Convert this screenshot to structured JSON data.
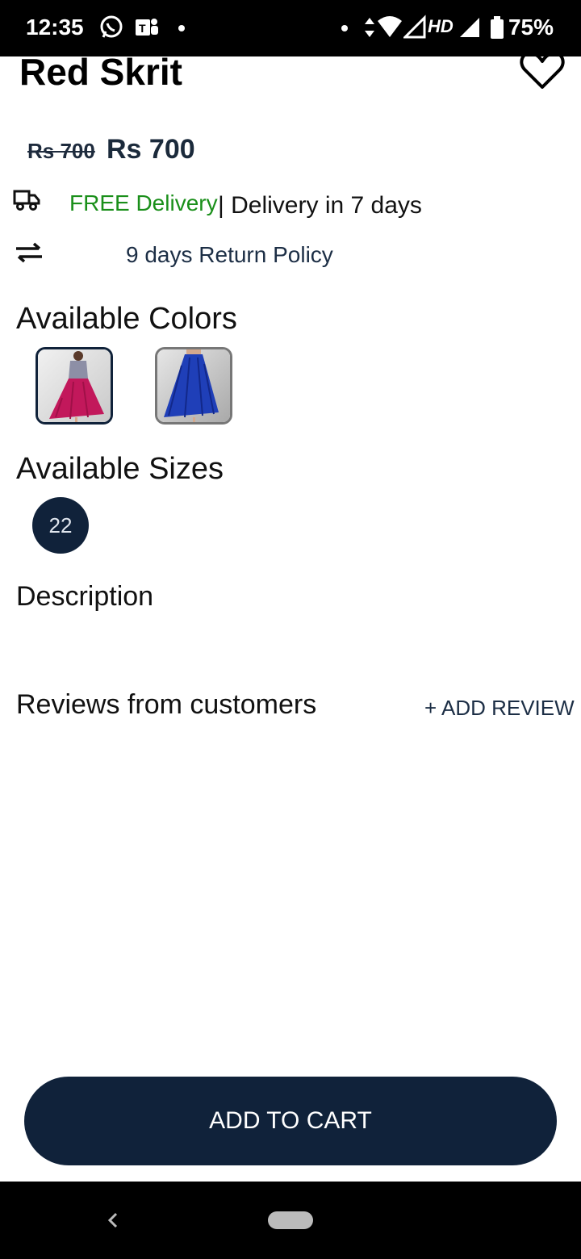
{
  "status_bar": {
    "time": "12:35",
    "network_label": "HD",
    "battery": "75%"
  },
  "product": {
    "title": "Red Skrit",
    "old_price": "Rs 700",
    "price": "Rs 700"
  },
  "delivery": {
    "free_label": "FREE Delivery",
    "days_label": "| Delivery in 7 days"
  },
  "return_policy": "9 days Return Policy",
  "colors": {
    "heading": "Available Colors",
    "options": [
      {
        "name": "red-skirt",
        "accent": "#c2185b",
        "selected": true
      },
      {
        "name": "blue-skirt",
        "accent": "#1f3fb8",
        "selected": false
      }
    ]
  },
  "sizes": {
    "heading": "Available Sizes",
    "options": [
      "22"
    ]
  },
  "description": {
    "heading": "Description"
  },
  "reviews": {
    "heading": "Reviews from customers",
    "add_label": "+ ADD REVIEW"
  },
  "cart": {
    "button_label": "ADD TO CART"
  },
  "colors_theme": {
    "primary": "#10223a",
    "free_delivery": "#1a8f1a"
  }
}
